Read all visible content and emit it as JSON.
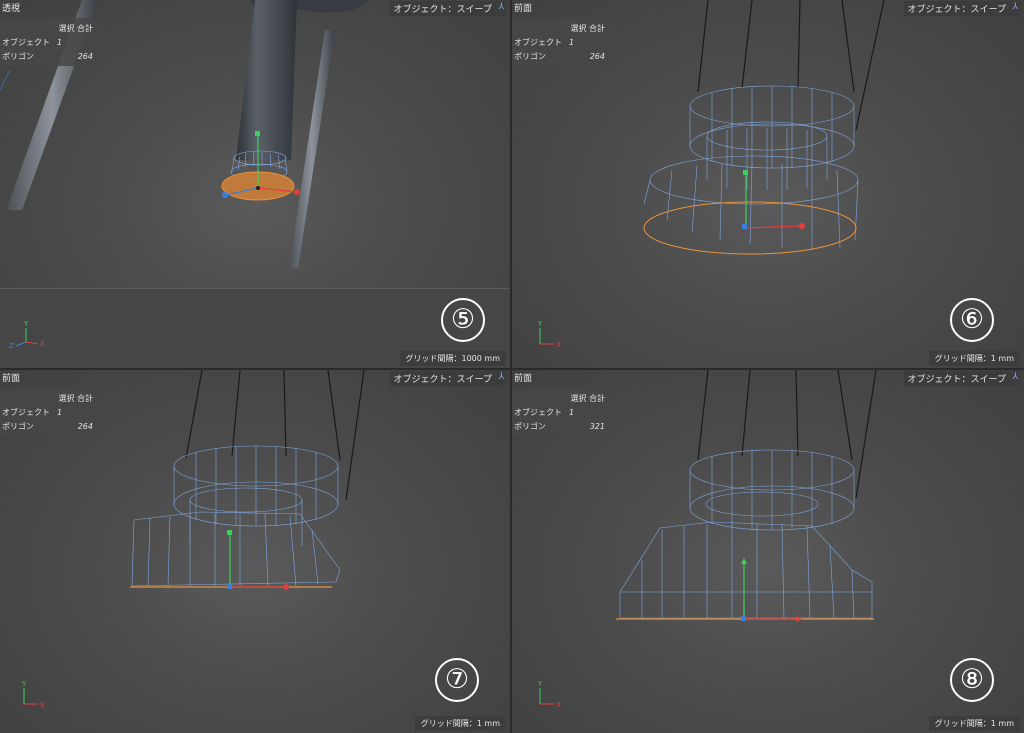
{
  "viewports": [
    {
      "id": "v5",
      "view_label": "透視",
      "object_label": "オブジェクト：スイープ",
      "stats": {
        "header": "選択 合計",
        "object_key": "オブジェクト",
        "object_val": "1",
        "polygon_key": "ポリゴン",
        "polygon_val": "264"
      },
      "grid_spacing": "グリッド間隔：1000 mm",
      "step_number": "⑤"
    },
    {
      "id": "v6",
      "view_label": "前面",
      "object_label": "オブジェクト：スイープ",
      "stats": {
        "header": "選択 合計",
        "object_key": "オブジェクト",
        "object_val": "1",
        "polygon_key": "ポリゴン",
        "polygon_val": "264"
      },
      "grid_spacing": "グリッド間隔：1 mm",
      "step_number": "⑥"
    },
    {
      "id": "v7",
      "view_label": "前面",
      "object_label": "オブジェクト：スイープ",
      "stats": {
        "header": "選択 合計",
        "object_key": "オブジェクト",
        "object_val": "1",
        "polygon_key": "ポリゴン",
        "polygon_val": "264"
      },
      "grid_spacing": "グリッド間隔：1 mm",
      "step_number": "⑦"
    },
    {
      "id": "v8",
      "view_label": "前面",
      "object_label": "オブジェクト：スイープ",
      "stats": {
        "header": "選択 合計",
        "object_key": "オブジェクト",
        "object_val": "1",
        "polygon_key": "ポリゴン",
        "polygon_val": "321"
      },
      "grid_spacing": "グリッド間隔：1 mm",
      "step_number": "⑧"
    }
  ],
  "axis_labels": {
    "x": "X",
    "y": "Y",
    "z": "Z"
  },
  "colors": {
    "wire": "#7ea7e0",
    "selected_edge": "#e8923a",
    "x_axis": "#e04040",
    "y_axis": "#3ccf5a",
    "z_axis": "#3a7ee0",
    "viewport_bg": "#4c4c4c"
  },
  "icons": {
    "object_icon": "sweep-icon"
  }
}
